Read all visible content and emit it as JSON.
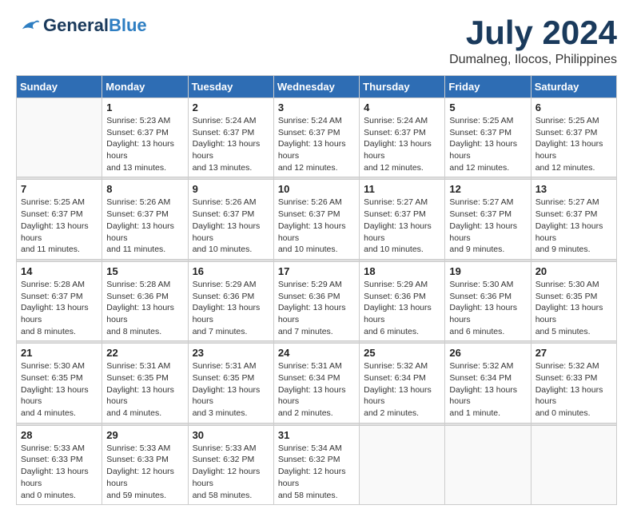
{
  "header": {
    "logo_line1": "General",
    "logo_line2": "Blue",
    "month": "July 2024",
    "location": "Dumalneg, Ilocos, Philippines"
  },
  "weekdays": [
    "Sunday",
    "Monday",
    "Tuesday",
    "Wednesday",
    "Thursday",
    "Friday",
    "Saturday"
  ],
  "weeks": [
    [
      {
        "day": "",
        "sunrise": "",
        "sunset": "",
        "daylight": ""
      },
      {
        "day": "1",
        "sunrise": "Sunrise: 5:23 AM",
        "sunset": "Sunset: 6:37 PM",
        "daylight": "Daylight: 13 hours and 13 minutes."
      },
      {
        "day": "2",
        "sunrise": "Sunrise: 5:24 AM",
        "sunset": "Sunset: 6:37 PM",
        "daylight": "Daylight: 13 hours and 13 minutes."
      },
      {
        "day": "3",
        "sunrise": "Sunrise: 5:24 AM",
        "sunset": "Sunset: 6:37 PM",
        "daylight": "Daylight: 13 hours and 12 minutes."
      },
      {
        "day": "4",
        "sunrise": "Sunrise: 5:24 AM",
        "sunset": "Sunset: 6:37 PM",
        "daylight": "Daylight: 13 hours and 12 minutes."
      },
      {
        "day": "5",
        "sunrise": "Sunrise: 5:25 AM",
        "sunset": "Sunset: 6:37 PM",
        "daylight": "Daylight: 13 hours and 12 minutes."
      },
      {
        "day": "6",
        "sunrise": "Sunrise: 5:25 AM",
        "sunset": "Sunset: 6:37 PM",
        "daylight": "Daylight: 13 hours and 12 minutes."
      }
    ],
    [
      {
        "day": "7",
        "sunrise": "Sunrise: 5:25 AM",
        "sunset": "Sunset: 6:37 PM",
        "daylight": "Daylight: 13 hours and 11 minutes."
      },
      {
        "day": "8",
        "sunrise": "Sunrise: 5:26 AM",
        "sunset": "Sunset: 6:37 PM",
        "daylight": "Daylight: 13 hours and 11 minutes."
      },
      {
        "day": "9",
        "sunrise": "Sunrise: 5:26 AM",
        "sunset": "Sunset: 6:37 PM",
        "daylight": "Daylight: 13 hours and 10 minutes."
      },
      {
        "day": "10",
        "sunrise": "Sunrise: 5:26 AM",
        "sunset": "Sunset: 6:37 PM",
        "daylight": "Daylight: 13 hours and 10 minutes."
      },
      {
        "day": "11",
        "sunrise": "Sunrise: 5:27 AM",
        "sunset": "Sunset: 6:37 PM",
        "daylight": "Daylight: 13 hours and 10 minutes."
      },
      {
        "day": "12",
        "sunrise": "Sunrise: 5:27 AM",
        "sunset": "Sunset: 6:37 PM",
        "daylight": "Daylight: 13 hours and 9 minutes."
      },
      {
        "day": "13",
        "sunrise": "Sunrise: 5:27 AM",
        "sunset": "Sunset: 6:37 PM",
        "daylight": "Daylight: 13 hours and 9 minutes."
      }
    ],
    [
      {
        "day": "14",
        "sunrise": "Sunrise: 5:28 AM",
        "sunset": "Sunset: 6:37 PM",
        "daylight": "Daylight: 13 hours and 8 minutes."
      },
      {
        "day": "15",
        "sunrise": "Sunrise: 5:28 AM",
        "sunset": "Sunset: 6:36 PM",
        "daylight": "Daylight: 13 hours and 8 minutes."
      },
      {
        "day": "16",
        "sunrise": "Sunrise: 5:29 AM",
        "sunset": "Sunset: 6:36 PM",
        "daylight": "Daylight: 13 hours and 7 minutes."
      },
      {
        "day": "17",
        "sunrise": "Sunrise: 5:29 AM",
        "sunset": "Sunset: 6:36 PM",
        "daylight": "Daylight: 13 hours and 7 minutes."
      },
      {
        "day": "18",
        "sunrise": "Sunrise: 5:29 AM",
        "sunset": "Sunset: 6:36 PM",
        "daylight": "Daylight: 13 hours and 6 minutes."
      },
      {
        "day": "19",
        "sunrise": "Sunrise: 5:30 AM",
        "sunset": "Sunset: 6:36 PM",
        "daylight": "Daylight: 13 hours and 6 minutes."
      },
      {
        "day": "20",
        "sunrise": "Sunrise: 5:30 AM",
        "sunset": "Sunset: 6:35 PM",
        "daylight": "Daylight: 13 hours and 5 minutes."
      }
    ],
    [
      {
        "day": "21",
        "sunrise": "Sunrise: 5:30 AM",
        "sunset": "Sunset: 6:35 PM",
        "daylight": "Daylight: 13 hours and 4 minutes."
      },
      {
        "day": "22",
        "sunrise": "Sunrise: 5:31 AM",
        "sunset": "Sunset: 6:35 PM",
        "daylight": "Daylight: 13 hours and 4 minutes."
      },
      {
        "day": "23",
        "sunrise": "Sunrise: 5:31 AM",
        "sunset": "Sunset: 6:35 PM",
        "daylight": "Daylight: 13 hours and 3 minutes."
      },
      {
        "day": "24",
        "sunrise": "Sunrise: 5:31 AM",
        "sunset": "Sunset: 6:34 PM",
        "daylight": "Daylight: 13 hours and 2 minutes."
      },
      {
        "day": "25",
        "sunrise": "Sunrise: 5:32 AM",
        "sunset": "Sunset: 6:34 PM",
        "daylight": "Daylight: 13 hours and 2 minutes."
      },
      {
        "day": "26",
        "sunrise": "Sunrise: 5:32 AM",
        "sunset": "Sunset: 6:34 PM",
        "daylight": "Daylight: 13 hours and 1 minute."
      },
      {
        "day": "27",
        "sunrise": "Sunrise: 5:32 AM",
        "sunset": "Sunset: 6:33 PM",
        "daylight": "Daylight: 13 hours and 0 minutes."
      }
    ],
    [
      {
        "day": "28",
        "sunrise": "Sunrise: 5:33 AM",
        "sunset": "Sunset: 6:33 PM",
        "daylight": "Daylight: 13 hours and 0 minutes."
      },
      {
        "day": "29",
        "sunrise": "Sunrise: 5:33 AM",
        "sunset": "Sunset: 6:33 PM",
        "daylight": "Daylight: 12 hours and 59 minutes."
      },
      {
        "day": "30",
        "sunrise": "Sunrise: 5:33 AM",
        "sunset": "Sunset: 6:32 PM",
        "daylight": "Daylight: 12 hours and 58 minutes."
      },
      {
        "day": "31",
        "sunrise": "Sunrise: 5:34 AM",
        "sunset": "Sunset: 6:32 PM",
        "daylight": "Daylight: 12 hours and 58 minutes."
      },
      {
        "day": "",
        "sunrise": "",
        "sunset": "",
        "daylight": ""
      },
      {
        "day": "",
        "sunrise": "",
        "sunset": "",
        "daylight": ""
      },
      {
        "day": "",
        "sunrise": "",
        "sunset": "",
        "daylight": ""
      }
    ]
  ]
}
